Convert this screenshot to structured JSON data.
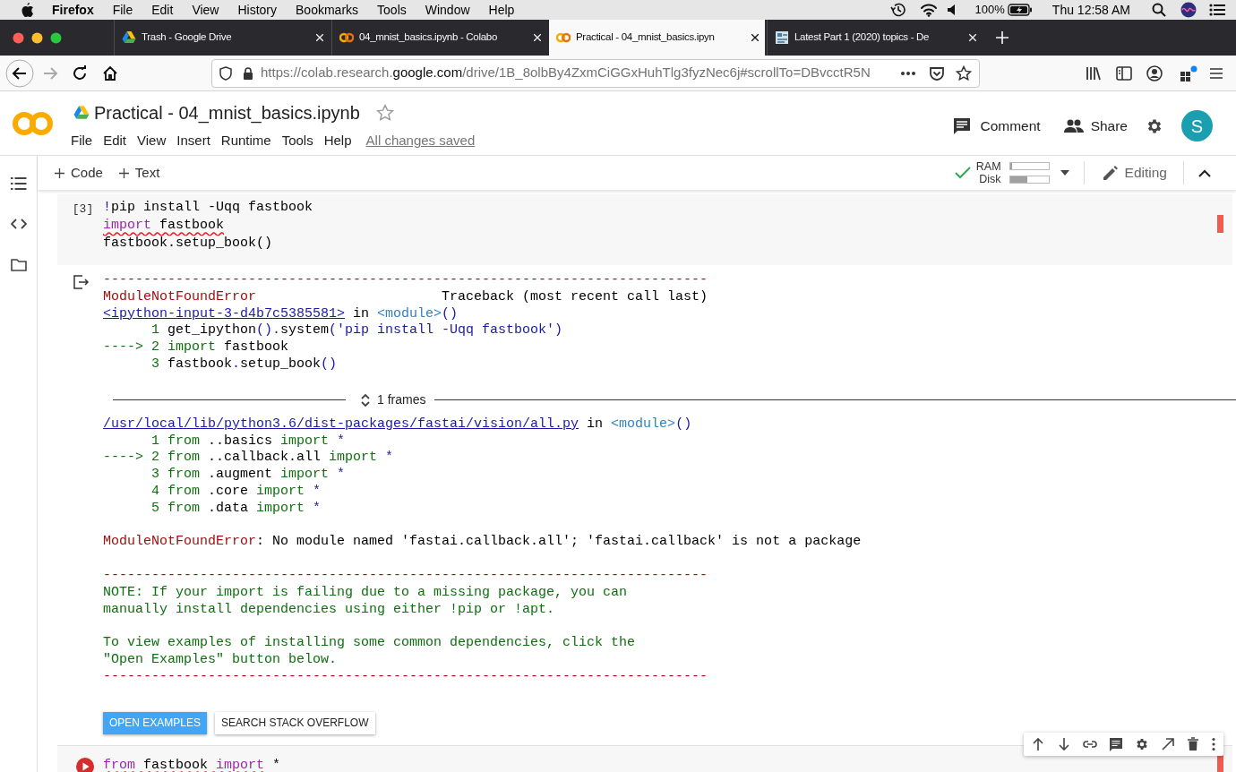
{
  "menu_bar": {
    "app": "Firefox",
    "items": [
      "File",
      "Edit",
      "View",
      "History",
      "Bookmarks",
      "Tools",
      "Window",
      "Help"
    ],
    "battery": "100%",
    "clock": "Thu 12:58 AM"
  },
  "tabs": [
    {
      "title": "Trash - Google Drive",
      "kind": "drive",
      "selected": false
    },
    {
      "title": "04_mnist_basics.ipynb - Colabo",
      "kind": "colab",
      "selected": false
    },
    {
      "title": "Practical - 04_mnist_basics.ipyn",
      "kind": "colab",
      "selected": true
    },
    {
      "title": "Latest Part 1 (2020) topics - De",
      "kind": "forum",
      "selected": false
    }
  ],
  "address_bar": {
    "url": "https://colab.research.**google.com**/drive/1B_8olbBy4ZxmCiGGxHuhTlg3fyzNec6j#scrollTo=DBvcctR5N"
  },
  "notebook": {
    "title": "Practical - 04_mnist_basics.ipynb",
    "menu": [
      "File",
      "Edit",
      "View",
      "Insert",
      "Runtime",
      "Tools",
      "Help"
    ],
    "save_status": "All changes saved",
    "comment": "Comment",
    "share": "Share",
    "avatar": "S"
  },
  "toolbar": {
    "add_code": "Code",
    "add_text": "Text",
    "resources": [
      {
        "label": "RAM",
        "level": 0.05
      },
      {
        "label": "Disk",
        "level": 0.45
      }
    ],
    "mode": "Editing"
  },
  "cells": [
    {
      "execution_count": "[3]",
      "has_error": true,
      "lines": [
        [
          {
            "text": "!",
            "kind": "shell",
            "misspelled": false
          },
          {
            "text": "pip install -Uqq fastbook",
            "kind": "plain",
            "misspelled": false
          }
        ],
        [
          {
            "text": "import",
            "kind": "keyword",
            "misspelled": true
          },
          {
            "text": " fastbook",
            "kind": "plain",
            "misspelled": true
          }
        ],
        [
          {
            "text": "fastbook.setup_book()",
            "kind": "plain",
            "misspelled": false
          }
        ]
      ],
      "output": [
        {
          "kind": "text",
          "lines": [
            [
              {
                "text": "---------------------------------------------------------------------------",
                "kind": "tb_error"
              }
            ],
            [
              {
                "text": "ModuleNotFoundError",
                "kind": "tb_error"
              },
              {
                "text": "                       Traceback (most recent call last)",
                "kind": "plain"
              }
            ],
            [
              {
                "text": "<ipython-input-3-d4b7c5385581>",
                "kind": "tb_link"
              },
              {
                "text": " in ",
                "kind": "plain"
              },
              {
                "text": "<module>",
                "kind": "tb_module"
              },
              {
                "text": "()",
                "kind": "tb_punct"
              }
            ],
            [
              {
                "text": "      1",
                "kind": "tb_keyword"
              },
              {
                "text": " get_ipython",
                "kind": "plain"
              },
              {
                "text": "().",
                "kind": "tb_punct"
              },
              {
                "text": "system",
                "kind": "plain"
              },
              {
                "text": "('pip install -Uqq fastbook')",
                "kind": "tb_punct"
              }
            ],
            [
              {
                "text": "----> 2 import",
                "kind": "tb_keyword"
              },
              {
                "text": " fastbook",
                "kind": "plain"
              }
            ],
            [
              {
                "text": "      3",
                "kind": "tb_keyword"
              },
              {
                "text": " fastbook",
                "kind": "plain"
              },
              {
                "text": ".",
                "kind": "tb_punct"
              },
              {
                "text": "setup_book",
                "kind": "plain"
              },
              {
                "text": "()",
                "kind": "tb_punct"
              }
            ]
          ]
        },
        {
          "kind": "frames",
          "label": "1 frames"
        },
        {
          "kind": "text",
          "lines": [
            [
              {
                "text": "/usr/local/lib/python3.6/dist-packages/fastai/vision/all.py",
                "kind": "tb_link"
              },
              {
                "text": " in ",
                "kind": "plain"
              },
              {
                "text": "<module>",
                "kind": "tb_module"
              },
              {
                "text": "()",
                "kind": "tb_punct"
              }
            ],
            [
              {
                "text": "      1 from",
                "kind": "tb_keyword"
              },
              {
                "text": " ..basics ",
                "kind": "plain"
              },
              {
                "text": "import",
                "kind": "tb_keyword"
              },
              {
                "text": " *",
                "kind": "tb_punct"
              }
            ],
            [
              {
                "text": "----> 2 from",
                "kind": "tb_keyword"
              },
              {
                "text": " ..callback.all ",
                "kind": "plain"
              },
              {
                "text": "import",
                "kind": "tb_keyword"
              },
              {
                "text": " *",
                "kind": "tb_punct"
              }
            ],
            [
              {
                "text": "      3 from",
                "kind": "tb_keyword"
              },
              {
                "text": " .augment ",
                "kind": "plain"
              },
              {
                "text": "import",
                "kind": "tb_keyword"
              },
              {
                "text": " *",
                "kind": "tb_punct"
              }
            ],
            [
              {
                "text": "      4 from",
                "kind": "tb_keyword"
              },
              {
                "text": " .core ",
                "kind": "plain"
              },
              {
                "text": "import",
                "kind": "tb_keyword"
              },
              {
                "text": " *",
                "kind": "tb_punct"
              }
            ],
            [
              {
                "text": "      5 from",
                "kind": "tb_keyword"
              },
              {
                "text": " .data ",
                "kind": "plain"
              },
              {
                "text": "import",
                "kind": "tb_keyword"
              },
              {
                "text": " *",
                "kind": "tb_punct"
              }
            ]
          ]
        },
        {
          "kind": "text",
          "lines": [
            [
              {
                "text": "ModuleNotFoundError",
                "kind": "tb_error"
              },
              {
                "text": ": No module named 'fastai.callback.all'; 'fastai.callback' is not a package",
                "kind": "plain"
              }
            ]
          ]
        },
        {
          "kind": "text",
          "lines": [
            [
              {
                "text": "---------------------------------------------------------------------------",
                "kind": "tb_error"
              }
            ],
            [
              {
                "text": "NOTE: If your import is failing due to a missing package, you can",
                "kind": "tb_note"
              }
            ],
            [
              {
                "text": "manually install dependencies using either !pip or !apt.",
                "kind": "tb_note"
              }
            ]
          ]
        },
        {
          "kind": "text",
          "lines": [
            [
              {
                "text": "To view examples of installing some common dependencies, click the",
                "kind": "tb_note"
              }
            ],
            [
              {
                "text": "\"Open Examples\" button below.",
                "kind": "tb_note"
              }
            ],
            [
              {
                "text": "---------------------------------------------------------------------------",
                "kind": "tb_error"
              }
            ]
          ]
        },
        {
          "kind": "buttons",
          "buttons": [
            {
              "label": "OPEN EXAMPLES",
              "primary": true
            },
            {
              "label": "SEARCH STACK OVERFLOW",
              "primary": false
            }
          ]
        }
      ]
    },
    {
      "has_error": true,
      "lines": [
        [
          {
            "text": "from",
            "kind": "keyword",
            "misspelled": true
          },
          {
            "text": " fastbook ",
            "kind": "plain",
            "misspelled": true
          },
          {
            "text": "import",
            "kind": "keyword",
            "misspelled": true
          },
          {
            "text": " *",
            "kind": "plain",
            "misspelled": false
          }
        ]
      ]
    }
  ]
}
